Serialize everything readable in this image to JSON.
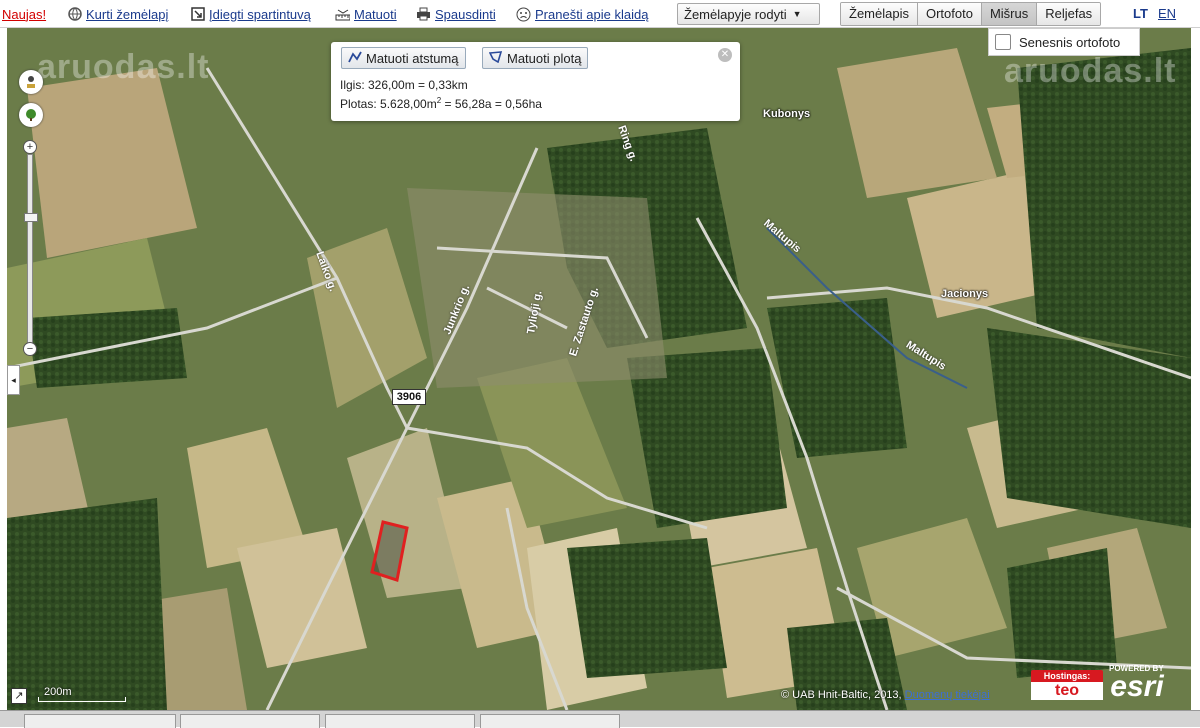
{
  "toolbar": {
    "new": "Naujas!",
    "create_map": "Kurti žemėlapį",
    "install_shortcut": "Įdiegti spartintuvą",
    "measure": "Matuoti",
    "print": "Spausdinti",
    "report_error": "Pranešti apie klaidą",
    "map_dropdown": "Žemėlapyje rodyti",
    "layers": [
      "Žemėlapis",
      "Ortofoto",
      "Mišrus",
      "Reljefas"
    ],
    "active_layer": "Mišrus",
    "lang_lt": "LT",
    "lang_en": "EN"
  },
  "measure_popup": {
    "distance_button": "Matuoti atstumą",
    "area_button": "Matuoti plotą",
    "length": "Ilgis: 326,00m = 0,33km",
    "area_prefix": "Plotas: 5.628,00m",
    "area_sup": "2",
    "area_suffix": " = 56,28a = 0,56ha"
  },
  "older_ortho": {
    "label": "Senesnis ortofoto",
    "checked": false
  },
  "watermark": "aruodas.lt",
  "map_labels": {
    "village1": "Kubonys",
    "village2": "Jacionys",
    "river1": "Maltupis",
    "river2": "Maltupis",
    "road_laiko": "Laiko g.",
    "road_junkrio": "Junkrio g.",
    "road_tylioji": "Tylioji g.",
    "road_zastaute": "E. Zastauto g.",
    "road_ring": "Ring g.",
    "highway": "3906"
  },
  "scale_label": "200m",
  "copyright": "© UAB Hnit-Baltic, 2013,",
  "copyright_link": "Duomenų tiekėjai",
  "hosting": {
    "label": "Hostingas:",
    "brand": "teo"
  },
  "esri": {
    "powered": "POWERED BY",
    "name": "esri"
  },
  "colors": {
    "parcel": "#e02020",
    "link": "#1a3a8c",
    "new": "#d20000"
  }
}
